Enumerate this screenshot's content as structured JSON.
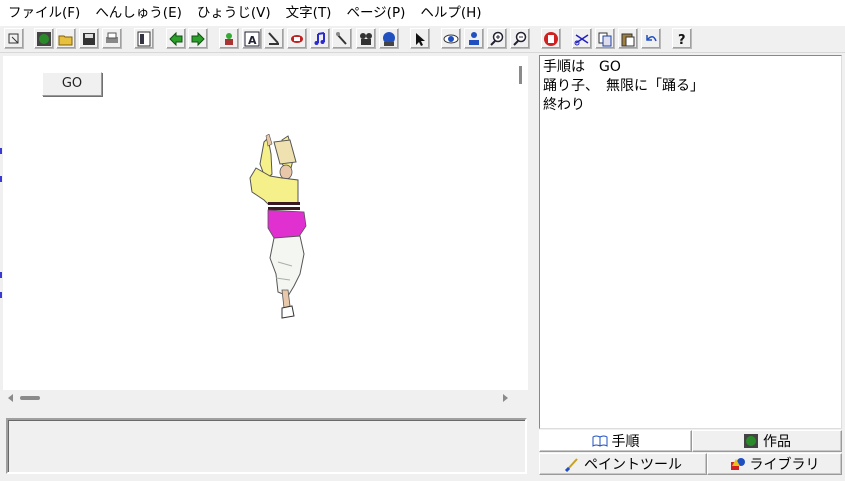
{
  "menu": [
    "ファイル(F)",
    "へんしゅう(E)",
    "ひょうじ(V)",
    "文字(T)",
    "ページ(P)",
    "ヘルプ(H)"
  ],
  "toolbar": {
    "icons": [
      "select-arrow-icon",
      "world-icon",
      "open-folder-icon",
      "save-icon",
      "print-icon",
      "page-layout-icon",
      "back-arrow-icon",
      "forward-arrow-icon",
      "character-icon",
      "text-tool-icon",
      "paint-brush-icon",
      "rectangle-tool-icon",
      "music-icon",
      "sound-icon",
      "movie-camera-icon",
      "globe-icon",
      "pointer-icon",
      "eye-icon",
      "stamp-icon",
      "zoom-in-icon",
      "zoom-out-icon",
      "stop-hand-icon",
      "scissors-icon",
      "copy-icon",
      "paste-icon",
      "undo-icon",
      "help-icon"
    ]
  },
  "stage": {
    "go_button_label": "GO"
  },
  "script": {
    "lines": [
      "手順は　GO",
      "踊り子、　無限に「踊る」",
      "終わり"
    ]
  },
  "tabs": {
    "procedure": "手順",
    "works": "作品",
    "paint_tool": "ペイントツール",
    "library": "ライブラリ"
  },
  "colors": {
    "dancer_sleeve": "#f6f08a",
    "dancer_skirt": "#e030d0",
    "window_bg": "#f0f0f0"
  }
}
